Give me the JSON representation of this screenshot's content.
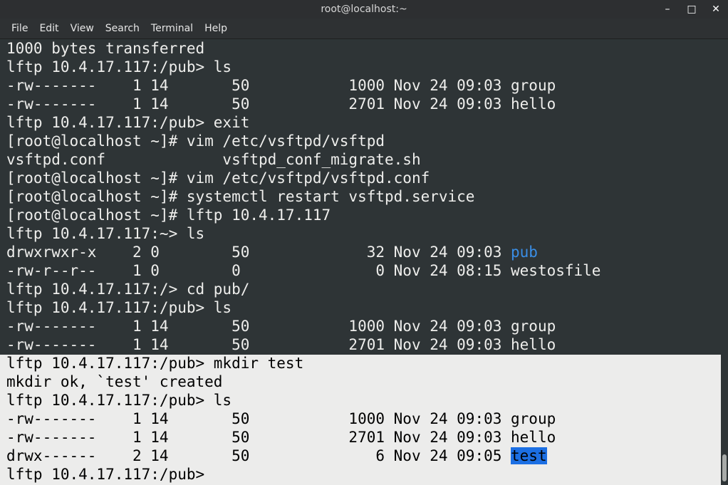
{
  "window": {
    "title": "root@localhost:~",
    "buttons": {
      "minimize": "–",
      "maximize": "□",
      "close": "✕"
    }
  },
  "menu": [
    "File",
    "Edit",
    "View",
    "Search",
    "Terminal",
    "Help"
  ],
  "terminal": {
    "lines": [
      "1000 bytes transferred",
      "lftp 10.4.17.117:/pub> ls",
      "-rw-------    1 14       50           1000 Nov 24 09:03 group",
      "-rw-------    1 14       50           2701 Nov 24 09:03 hello",
      "lftp 10.4.17.117:/pub> exit",
      "[root@localhost ~]# vim /etc/vsftpd/vsftpd",
      "vsftpd.conf             vsftpd_conf_migrate.sh",
      "[root@localhost ~]# vim /etc/vsftpd/vsftpd.conf",
      "[root@localhost ~]# systemctl restart vsftpd.service",
      "[root@localhost ~]# lftp 10.4.17.117",
      "lftp 10.4.17.117:~> ls",
      {
        "prefix": "drwxrwxr-x    2 0        50             32 Nov 24 09:03 ",
        "name": "pub",
        "style": "blue"
      },
      "-rw-r--r--    1 0        0               0 Nov 24 08:15 westosfile",
      "lftp 10.4.17.117:/> cd pub/",
      "lftp 10.4.17.117:/pub> ls",
      "-rw-------    1 14       50           1000 Nov 24 09:03 group",
      "-rw-------    1 14       50           2701 Nov 24 09:03 hello",
      "lftp 10.4.17.117:/pub> mkdir test",
      "mkdir ok, `test' created",
      "lftp 10.4.17.117:/pub> ls",
      "-rw-------    1 14       50           1000 Nov 24 09:03 group",
      "-rw-------    1 14       50           2701 Nov 24 09:03 hello",
      {
        "prefix": "drwx------    2 14       50              6 Nov 24 09:05 ",
        "name": "test",
        "style": "hl"
      },
      "lftp 10.4.17.117:/pub> "
    ],
    "selection_start_line": 17
  },
  "colors": {
    "terminal_bg": "#2e3436",
    "text": "#eeeeec",
    "dir_blue": "#3a8ee6",
    "selection_bg": "#ececeb",
    "highlight_bg": "#1c6fe3"
  },
  "icons": [
    "minimize-icon",
    "maximize-icon",
    "close-icon"
  ]
}
